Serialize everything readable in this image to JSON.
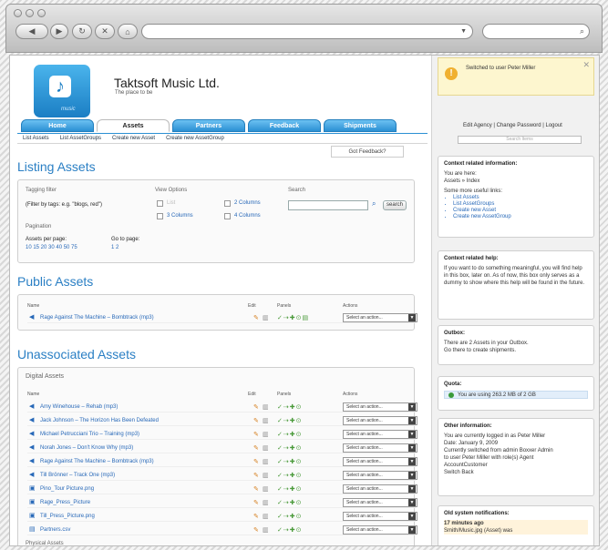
{
  "browser": {
    "back": "◀",
    "forward": "▶",
    "reload": "↻",
    "stop": "✕",
    "home": "⌂",
    "url": "",
    "search": ""
  },
  "header": {
    "company": "Taktsoft Music Ltd.",
    "tagline": "The place to be",
    "logo_text": "music"
  },
  "tabs": [
    {
      "label": "Home"
    },
    {
      "label": "Assets"
    },
    {
      "label": "Partners"
    },
    {
      "label": "Feedback"
    },
    {
      "label": "Shipments"
    }
  ],
  "subnav": [
    "List Assets",
    "List AssetGroups",
    "Create new Asset",
    "Create new AssetGroup"
  ],
  "feedback": "Got Feedback?",
  "listing": {
    "title": "Listing Assets",
    "tagging_filter": "Tagging filter",
    "filter_hint": "(Filter by tags: e.g. \"blogs, red\")",
    "view_options": "View Options",
    "opt_list": "List",
    "opt_2col": "2 Columns",
    "opt_3col": "3 Columns",
    "opt_4col": "4 Columns",
    "search_label": "Search",
    "search_button": "search",
    "pagination": "Pagination",
    "assets_per_page": "Assets per page:",
    "per_page_values": "10 15 20 30 40 50 75",
    "go_to_page": "Go to page:",
    "pages": "1 2"
  },
  "public_assets": {
    "title": "Public Assets",
    "col_name": "Name",
    "col_edit": "Edit",
    "col_panels": "Panels",
    "col_actions": "Actions",
    "rows": [
      {
        "name": "Rage Against The Machine – Bombtrack (mp3)",
        "action": "Select an action..."
      }
    ]
  },
  "unassociated": {
    "title": "Unassociated Assets",
    "subtitle": "Digital Assets",
    "col_name": "Name",
    "col_edit": "Edit",
    "col_panels": "Panels",
    "col_actions": "Actions",
    "rows": [
      {
        "icon": "audio",
        "name": "Amy Winehouse – Rehab (mp3)",
        "action": "Select an action..."
      },
      {
        "icon": "audio",
        "name": "Jack Johnson – The Horizon Has Been Defeated",
        "action": "Select an action..."
      },
      {
        "icon": "audio",
        "name": "Michael Petrucciani Trio – Training (mp3)",
        "action": "Select an action..."
      },
      {
        "icon": "audio",
        "name": "Norah Jones – Don't Know Why (mp3)",
        "action": "Select an action..."
      },
      {
        "icon": "audio",
        "name": "Rage Against The Machine – Bombtrack (mp3)",
        "action": "Select an action..."
      },
      {
        "icon": "audio",
        "name": "Till Brönner – Track One (mp3)",
        "action": "Select an action..."
      },
      {
        "icon": "image",
        "name": "Pino_Tour Picture.png",
        "action": "Select an action..."
      },
      {
        "icon": "image",
        "name": "Rage_Press_Picture",
        "action": "Select an action..."
      },
      {
        "icon": "image",
        "name": "Till_Press_Picture.png",
        "action": "Select an action..."
      },
      {
        "icon": "doc",
        "name": "Partners.csv",
        "action": "Select an action..."
      }
    ],
    "next_subtitle": "Physical Assets"
  },
  "sidebar": {
    "notification": "Switched to user Peter Miller",
    "account_links": "Edit Agency | Change Password | Logout",
    "search_placeholder": "Search Items",
    "context_info": {
      "title": "Context related information:",
      "you_are_here": "You are here:",
      "crumb": "Assets » Index",
      "more_links": "Some more useful links:",
      "links": [
        "List Assets",
        "List AssetGroups",
        "Create new Asset",
        "Create new AssetGroup"
      ]
    },
    "context_help": {
      "title": "Context related help:",
      "text": "If you want to do something meaningful, you will find help in this box, later on. As of now, this box only serves as a dummy to show where this help will be found in the future."
    },
    "outbox": {
      "title": "Outbox:",
      "text1": "There are 2 Assets in your Outbox.",
      "text2": "Go there to create shipments."
    },
    "quota": {
      "title": "Quota:",
      "text": "You are using 263.2 MB of 2 GB"
    },
    "other": {
      "title": "Other information:",
      "lines": [
        "You are currently logged in as Peter Miller",
        "Date: January 9, 2009",
        "Currently switched from admin Boxxer Admin",
        "to user Peter Miller with role(s) Agent",
        "AccountCustomer",
        "Switch Back"
      ]
    },
    "old_notifications": {
      "title": "Old system notifications:",
      "time": "17 minutes ago",
      "text": "Smith/Music.jpg (Asset) was"
    }
  },
  "colors": {
    "accent": "#2a7fc4",
    "tab_blue": "#2b90d3",
    "notice": "#fdf6cf"
  }
}
